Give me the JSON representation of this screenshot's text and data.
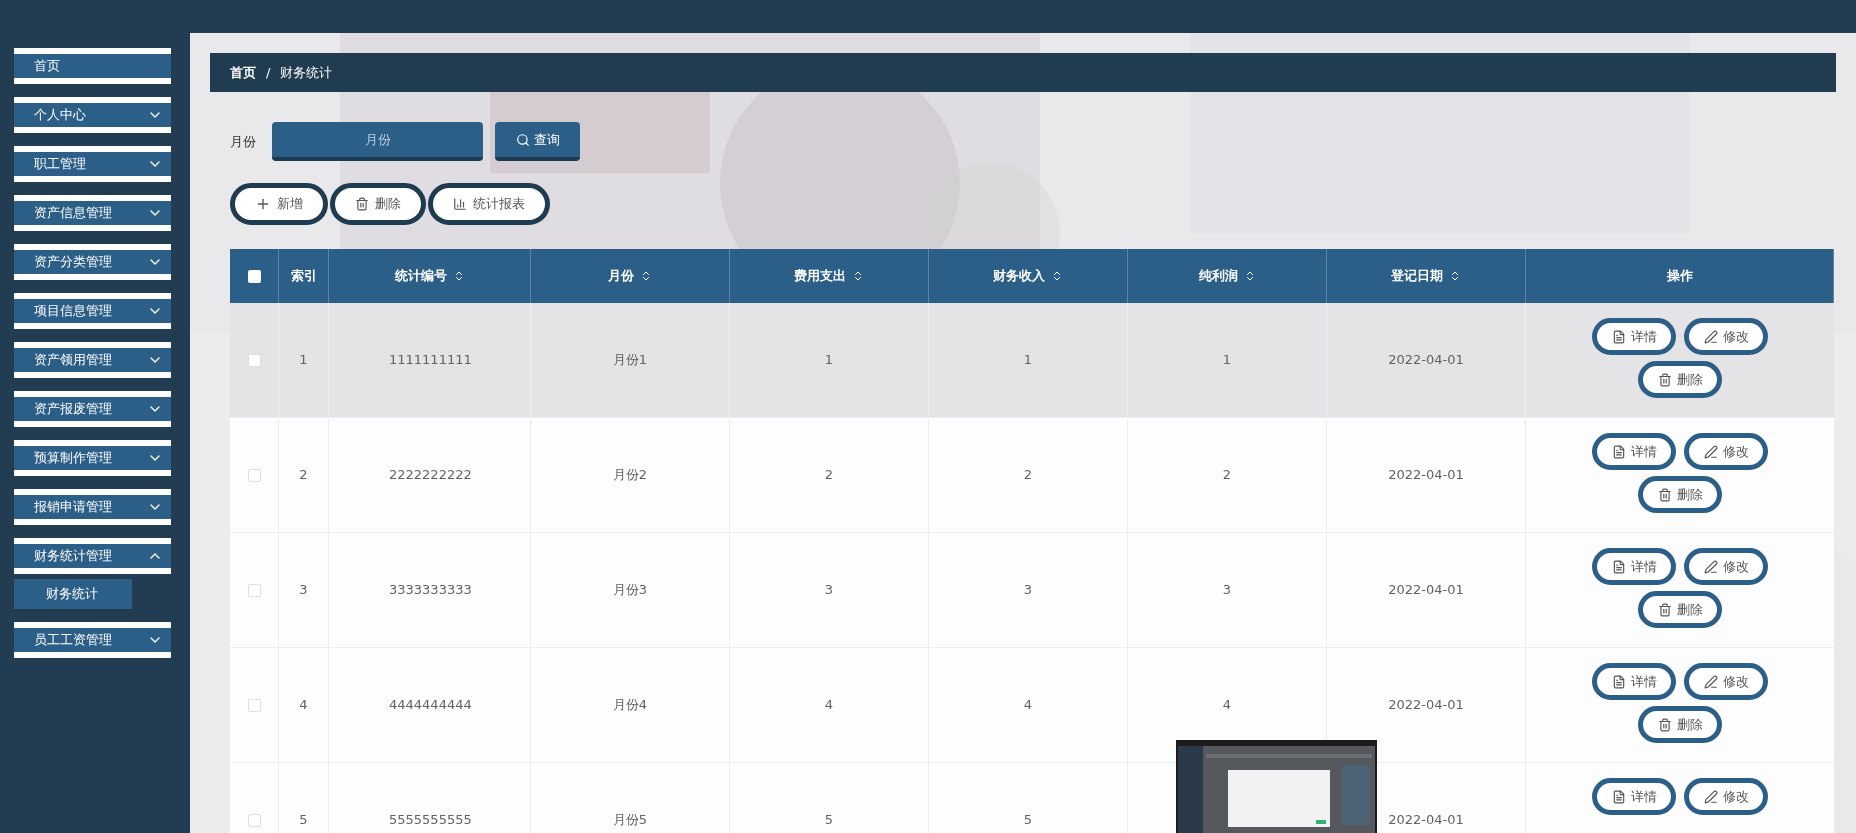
{
  "sidebar": {
    "items": [
      {
        "label": "首页",
        "kind": "link",
        "selected": false
      },
      {
        "label": "个人中心",
        "kind": "menu",
        "expanded": false,
        "selected": false
      },
      {
        "label": "职工管理",
        "kind": "menu",
        "expanded": false,
        "selected": false
      },
      {
        "label": "资产信息管理",
        "kind": "menu",
        "expanded": false,
        "selected": false
      },
      {
        "label": "资产分类管理",
        "kind": "menu",
        "expanded": false,
        "selected": false
      },
      {
        "label": "项目信息管理",
        "kind": "menu",
        "expanded": false,
        "selected": false
      },
      {
        "label": "资产领用管理",
        "kind": "menu",
        "expanded": false,
        "selected": false
      },
      {
        "label": "资产报废管理",
        "kind": "menu",
        "expanded": false,
        "selected": false
      },
      {
        "label": "预算制作管理",
        "kind": "menu",
        "expanded": false,
        "selected": false
      },
      {
        "label": "报销申请管理",
        "kind": "menu",
        "expanded": false,
        "selected": false
      },
      {
        "label": "财务统计管理",
        "kind": "menu",
        "expanded": true,
        "selected": false,
        "children": [
          {
            "label": "财务统计",
            "selected": true
          }
        ]
      },
      {
        "label": "员工工资管理",
        "kind": "menu",
        "expanded": false,
        "selected": false
      }
    ]
  },
  "breadcrumb": [
    "首页",
    "/",
    "财务统计"
  ],
  "search": {
    "label": "月份",
    "placeholder": "月份",
    "button": "查询"
  },
  "actions": [
    {
      "label": "新增",
      "kind": "add"
    },
    {
      "label": "删除",
      "kind": "delete"
    },
    {
      "label": "统计报表",
      "kind": "chart"
    }
  ],
  "table": {
    "columns": [
      {
        "label": "索引",
        "sortable": false
      },
      {
        "label": "统计编号",
        "sortable": true
      },
      {
        "label": "月份",
        "sortable": true
      },
      {
        "label": "费用支出",
        "sortable": true
      },
      {
        "label": "财务收入",
        "sortable": true
      },
      {
        "label": "纯利润",
        "sortable": true
      },
      {
        "label": "登记日期",
        "sortable": true
      },
      {
        "label": "操作",
        "sortable": false
      }
    ],
    "header_checked": false,
    "rows": [
      {
        "cells": [
          "1",
          "1111111111",
          "月份1",
          "1",
          "1",
          "1",
          "2022-04-01"
        ],
        "checked": false,
        "hovered": true,
        "buttons": [
          {
            "label": "详情",
            "kind": "detail"
          },
          {
            "label": "修改",
            "kind": "edit"
          },
          {
            "label": "删除",
            "kind": "delete"
          }
        ]
      },
      {
        "cells": [
          "2",
          "2222222222",
          "月份2",
          "2",
          "2",
          "2",
          "2022-04-01"
        ],
        "checked": false,
        "hovered": false,
        "buttons": [
          {
            "label": "详情",
            "kind": "detail"
          },
          {
            "label": "修改",
            "kind": "edit"
          },
          {
            "label": "删除",
            "kind": "delete"
          }
        ]
      },
      {
        "cells": [
          "3",
          "3333333333",
          "月份3",
          "3",
          "3",
          "3",
          "2022-04-01"
        ],
        "checked": false,
        "hovered": false,
        "buttons": [
          {
            "label": "详情",
            "kind": "detail"
          },
          {
            "label": "修改",
            "kind": "edit"
          },
          {
            "label": "删除",
            "kind": "delete"
          }
        ]
      },
      {
        "cells": [
          "4",
          "4444444444",
          "月份4",
          "4",
          "4",
          "4",
          "2022-04-01"
        ],
        "checked": false,
        "hovered": false,
        "buttons": [
          {
            "label": "详情",
            "kind": "detail"
          },
          {
            "label": "修改",
            "kind": "edit"
          },
          {
            "label": "删除",
            "kind": "delete"
          }
        ]
      },
      {
        "cells": [
          "5",
          "5555555555",
          "月份5",
          "5",
          "5",
          null,
          "2022-04-01"
        ],
        "checked": false,
        "hovered": false,
        "buttons": [
          {
            "label": "详情",
            "kind": "detail"
          },
          {
            "label": "修改",
            "kind": "edit"
          }
        ]
      }
    ]
  }
}
